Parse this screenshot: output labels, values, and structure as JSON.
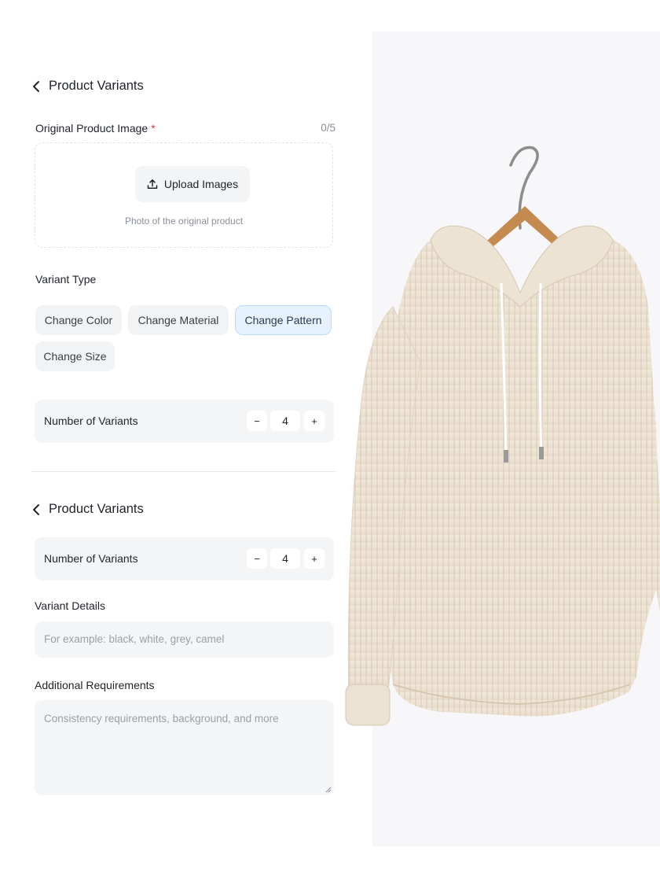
{
  "section1": {
    "back_title": "Product Variants",
    "image_label": "Original Product Image",
    "required_mark": "*",
    "image_count": "0/5",
    "upload_button": "Upload Images",
    "upload_hint": "Photo of the original product",
    "variant_type_label": "Variant Type",
    "variant_types": [
      "Change Color",
      "Change Material",
      "Change Pattern",
      "Change Size"
    ],
    "selected_variant_type": "Change Pattern",
    "number_label": "Number of Variants",
    "number_value": "4",
    "minus": "−",
    "plus": "+"
  },
  "section2": {
    "back_title": "Product Variants",
    "number_label": "Number of Variants",
    "number_value": "4",
    "minus": "−",
    "plus": "+",
    "details_label": "Variant Details",
    "details_placeholder": "For example: black, white, grey, camel",
    "requirements_label": "Additional Requirements",
    "requirements_placeholder": "Consistency requirements, background, and more"
  },
  "colors": {
    "accent_chip_bg": "#e6f2ff",
    "accent_chip_border": "#b9d9fb",
    "required": "#e53935"
  },
  "icons": [
    "chevron-left-icon",
    "upload-icon",
    "resize-grip-icon"
  ]
}
